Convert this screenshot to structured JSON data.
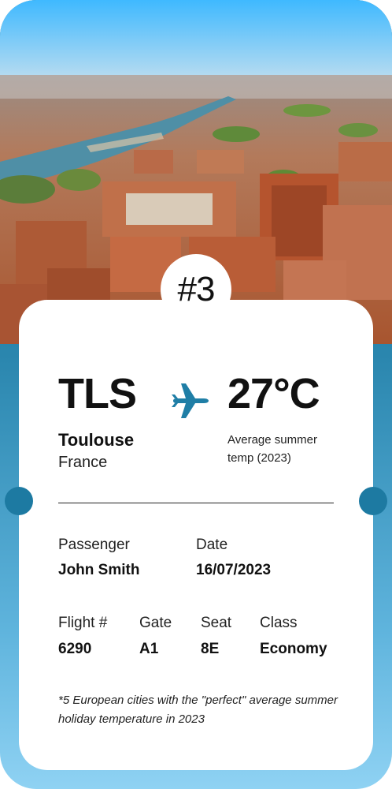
{
  "badge": {
    "number": "#3"
  },
  "route": {
    "code": "TLS",
    "city": "Toulouse",
    "country": "France",
    "temperature": "27°C",
    "temperature_note": "Average summer temp (2023)"
  },
  "details": {
    "passenger_label": "Passenger",
    "passenger_value": "John Smith",
    "date_label": "Date",
    "date_value": "16/07/2023",
    "flight_label": "Flight #",
    "flight_value": "6290",
    "gate_label": "Gate",
    "gate_value": "A1",
    "seat_label": "Seat",
    "seat_value": "8E",
    "class_label": "Class",
    "class_value": "Economy"
  },
  "footnote": "*5 European cities with the \"perfect\" average summer holiday temperature in 2023",
  "colors": {
    "accent": "#1f7ea6",
    "background_top": "#0e6a8c",
    "background_bottom": "#8fd2f3",
    "ticket": "#ffffff"
  },
  "icons": {
    "plane": "airplane-icon"
  }
}
